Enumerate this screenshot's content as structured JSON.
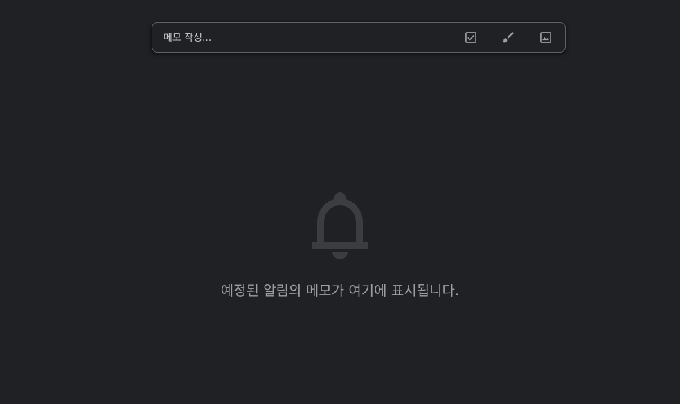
{
  "note_input": {
    "placeholder": "메모 작성..."
  },
  "note_actions": [
    {
      "name": "checkbox-list-icon",
      "label": "new list"
    },
    {
      "name": "brush-icon",
      "label": "new drawing"
    },
    {
      "name": "image-icon",
      "label": "new note with image"
    }
  ],
  "empty_state": {
    "icon": "bell-icon",
    "message": "예정된 알림의 메모가 여기에 표시됩니다."
  },
  "colors": {
    "background": "#202124",
    "border": "#5f6368",
    "icon": "#9aa0a6",
    "empty_icon": "#3c3d40",
    "text_muted": "#9aa0a6"
  }
}
